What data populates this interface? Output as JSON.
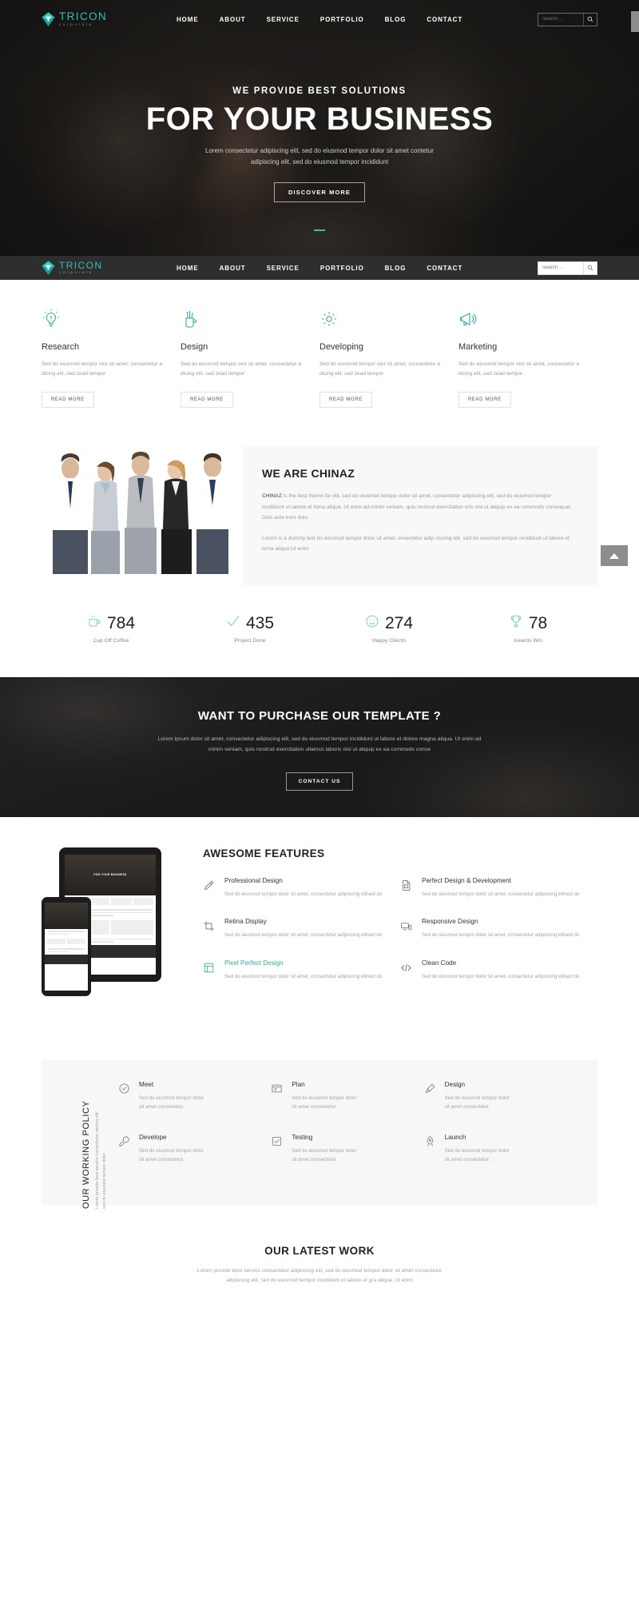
{
  "brand": {
    "name": "TRICON",
    "tagline": "corporate"
  },
  "nav": {
    "items": [
      "HOME",
      "ABOUT",
      "SERVICE",
      "PORTFOLIO",
      "BLOG",
      "CONTACT"
    ]
  },
  "search": {
    "placeholder": "Search ...",
    "icon": "search-icon"
  },
  "hero": {
    "kicker": "WE PROVIDE BEST SOLUTIONS",
    "title": "FOR YOUR BUSINESS",
    "desc_line1": "Lorem consectetur adipiscing elit, sed do eiusmod tempor dolor sit amet contetur",
    "desc_line2": "adipiscing elit, sed do eiusmod tempor incididunt",
    "button": "DISCOVER MORE"
  },
  "services": {
    "read_more": "READ MORE",
    "items": [
      {
        "icon": "lightbulb-icon",
        "title": "Research",
        "desc": "Sed do eiusmod tempor olor sit amet, consectetur a dicing elit, sed zead tempor"
      },
      {
        "icon": "pencil-cup-icon",
        "title": "Design",
        "desc": "Sed do eiusmod tempor olor sit amet, consectetur a dicing elit, sed zead tempor"
      },
      {
        "icon": "gear-icon",
        "title": "Developing",
        "desc": "Sed do eiusmod tempor olor sit amet, consectetur a dicing elit, sed zead tempor"
      },
      {
        "icon": "megaphone-icon",
        "title": "Marketing",
        "desc": "Sed do eiusmod tempor olor sit amet, consectetur a dicing elit, sed zead tempor"
      }
    ]
  },
  "about": {
    "title": "WE ARE CHINAZ",
    "p1_lead": "CHINAZ",
    "p1": " is the best theme for elit, sed do eiusmod tempor dolor sit amet, consectetur adipiscing elit, sed do eiusmod tempor incididunt ut labore et lorna aliqua. Ut enim ad minim veniam, quis nostrud exercitation orts nisi ut aliquip ex ea commodo consequat. Duis aute irure dolo.",
    "p2": "Lorem is a dummy text do eiusmod tempor dolor sit amet, onsectetur adip niscing elit, sed do eiusmod tempor incididunt ut labore et lorna aliqua Ut enim"
  },
  "counters": [
    {
      "icon": "coffee-cup-icon",
      "value": "784",
      "label": "Cup Off Coffee"
    },
    {
      "icon": "check-icon",
      "value": "435",
      "label": "Project Done"
    },
    {
      "icon": "smiley-icon",
      "value": "274",
      "label": "Happy Clients"
    },
    {
      "icon": "trophy-icon",
      "value": "78",
      "label": "Awards Win"
    }
  ],
  "cta": {
    "title": "WANT TO PURCHASE OUR TEMPLATE ?",
    "desc_line1": "Lorem ipsum dolor sit amet, consectetur adipiscing elit, sed do eiusmod tempor incididunt ut labore et dolore magna aliqua. Ut enim ad",
    "desc_line2": "minim veniam, quis nostrud exercitation ullamco laboris nisi ut aliquip ex ea commodo conse",
    "button": "CONTACT US"
  },
  "features": {
    "title": "AWESOME FEATURES",
    "mockup_caption": "FOR YOUR BUSINESS",
    "items": [
      {
        "icon": "pencil-icon",
        "title": "Professional Design",
        "desc": "Sed do eiusmod tempor dolor sit amet, consectetur adipiscing elitsed do",
        "accent": false
      },
      {
        "icon": "document-icon",
        "title": "Perfect Design & Development",
        "desc": "Sed do eiusmod tempor dolor sit amet, consectetur adipiscing elitsed do",
        "accent": false
      },
      {
        "icon": "crop-icon",
        "title": "Retina Display",
        "desc": "Sed do eiusmod tempor dolor sit amet, consectetur adipiscing elitsed do",
        "accent": false
      },
      {
        "icon": "devices-icon",
        "title": "Responsive Design",
        "desc": "Sed do eiusmod tempor dolor sit amet, consectetur adipiscing elitsed do",
        "accent": false
      },
      {
        "icon": "grid-icon",
        "title": "Pixel Perfect Design",
        "desc": "Sed do eiusmod tempor dolor sit amet, consectetur adipiscing elitsed do",
        "accent": true
      },
      {
        "icon": "code-icon",
        "title": "Clean Code",
        "desc": "Sed do eiusmod tempor dolor sit amet, consectetur adipiscing elitsed do",
        "accent": false
      }
    ]
  },
  "policy": {
    "title": "OUR WORKING POLICY",
    "subtitle_line1": "Lorem provide best service consectetur aiscing elit,",
    "subtitle_line2": "sed do eiusmod tempor dolor",
    "items": [
      {
        "icon": "handshake-icon",
        "title": "Meet",
        "desc_line1": "Sed do eiusmod tempor dolor",
        "desc_line2": "sit amet consectetur."
      },
      {
        "icon": "plan-icon",
        "title": "Plan",
        "desc_line1": "Sed do eiusmod tempor dolor",
        "desc_line2": "sit amet consectetur."
      },
      {
        "icon": "brush-icon",
        "title": "Design",
        "desc_line1": "Sed do eiusmod tempor dolor",
        "desc_line2": "sit amet consectetur."
      },
      {
        "icon": "wrench-icon",
        "title": "Develope",
        "desc_line1": "Sed do eiusmod tempor dolor",
        "desc_line2": "sit amet consectetur."
      },
      {
        "icon": "checklist-icon",
        "title": "Testing",
        "desc_line1": "Sed do eiusmod tempor dolor",
        "desc_line2": "sit amet consectetur."
      },
      {
        "icon": "rocket-icon",
        "title": "Launch",
        "desc_line1": "Sed do eiusmod tempor dolor",
        "desc_line2": "sit amet consectetur."
      }
    ]
  },
  "work": {
    "title": "OUR LATEST WORK",
    "desc_line1": "Lorem provide best service consectetur adipiscing elit, sed do eiusmod tempor dolor sit amet consectetur",
    "desc_line2": "adipiscing elit, sed do eiusmod tempor incididunt ut labore et gra aliqua. Ut enim"
  },
  "colors": {
    "accent": "#2fc0b6",
    "accent_dark": "#2fae9e",
    "dark_bar": "#2e2e2e",
    "scrolltop": "#8d8d8d"
  }
}
